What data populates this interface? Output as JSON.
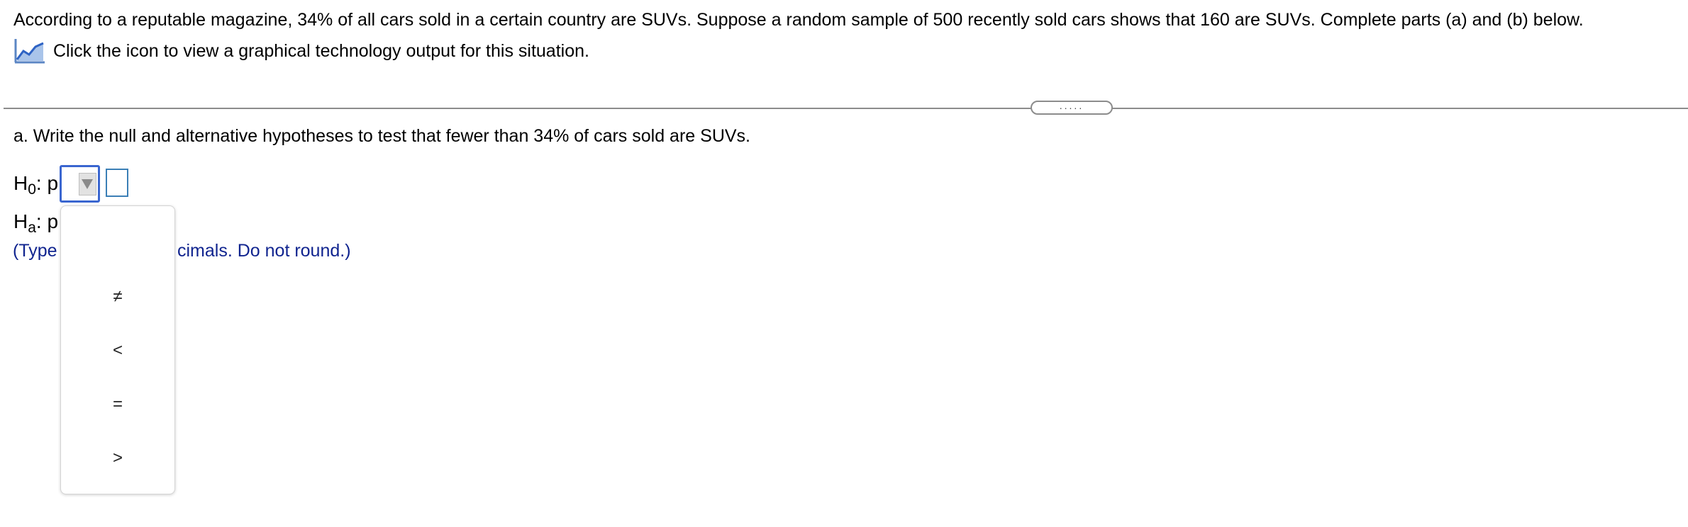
{
  "problem": {
    "statement": "According to a reputable magazine, 34% of all cars sold in a certain country are SUVs. Suppose a random sample of 500 recently sold cars shows that 160 are SUVs. Complete parts (a) and (b) below.",
    "tech_link_text": "Click the icon to view a graphical technology output for this situation.",
    "tech_icon": "graph-chart-icon"
  },
  "divider": {
    "handle_text": "....."
  },
  "part_a": {
    "prompt": "a. Write the null and alternative hypotheses to test that fewer than 34% of cars sold are SUVs.",
    "h0": {
      "h": "H",
      "sub": "0",
      "rest": ": p"
    },
    "ha": {
      "h": "H",
      "sub": "a",
      "rest": ": p"
    },
    "hint_left": "(Type",
    "hint_right": "cimals. Do not round.)",
    "value_input": ""
  },
  "dropdown": {
    "options": [
      "≠",
      "<",
      "=",
      ">"
    ]
  },
  "colors": {
    "accent_border": "#3a66d0",
    "hint_text": "#10248f",
    "input_border": "#3b7fb6"
  }
}
